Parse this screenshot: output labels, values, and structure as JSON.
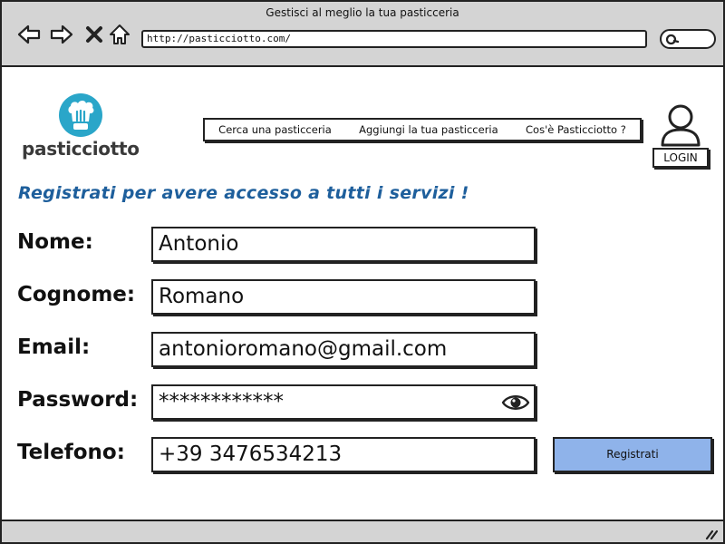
{
  "window": {
    "title": "Gestisci al meglio la tua pasticceria"
  },
  "browser": {
    "url": "http://pasticciotto.com/",
    "icons": [
      "back-arrow-icon",
      "forward-arrow-icon",
      "close-x-icon",
      "home-icon",
      "search-icon"
    ]
  },
  "header": {
    "logo_text": "pasticciotto",
    "menu": [
      {
        "label": "Cerca una pasticceria"
      },
      {
        "label": "Aggiungi la tua pasticceria"
      },
      {
        "label": "Cos'è Pasticciotto ?"
      }
    ],
    "login_label": "LOGIN"
  },
  "form": {
    "heading": "Registrati per avere accesso a tutti i servizi !",
    "fields": {
      "nome": {
        "label": "Nome:",
        "value": "Antonio"
      },
      "cognome": {
        "label": "Cognome:",
        "value": "Romano"
      },
      "email": {
        "label": "Email:",
        "value": "antonioromano@gmail.com"
      },
      "password": {
        "label": "Password:",
        "value": "************"
      },
      "telefono": {
        "label": "Telefono:",
        "value": "+39 3476534213"
      }
    },
    "submit_label": "Registrati"
  },
  "colors": {
    "chrome": "#d4d4d4",
    "logo": "#2aa6c9",
    "heading": "#1e5f9c",
    "button": "#8fb3ea"
  }
}
